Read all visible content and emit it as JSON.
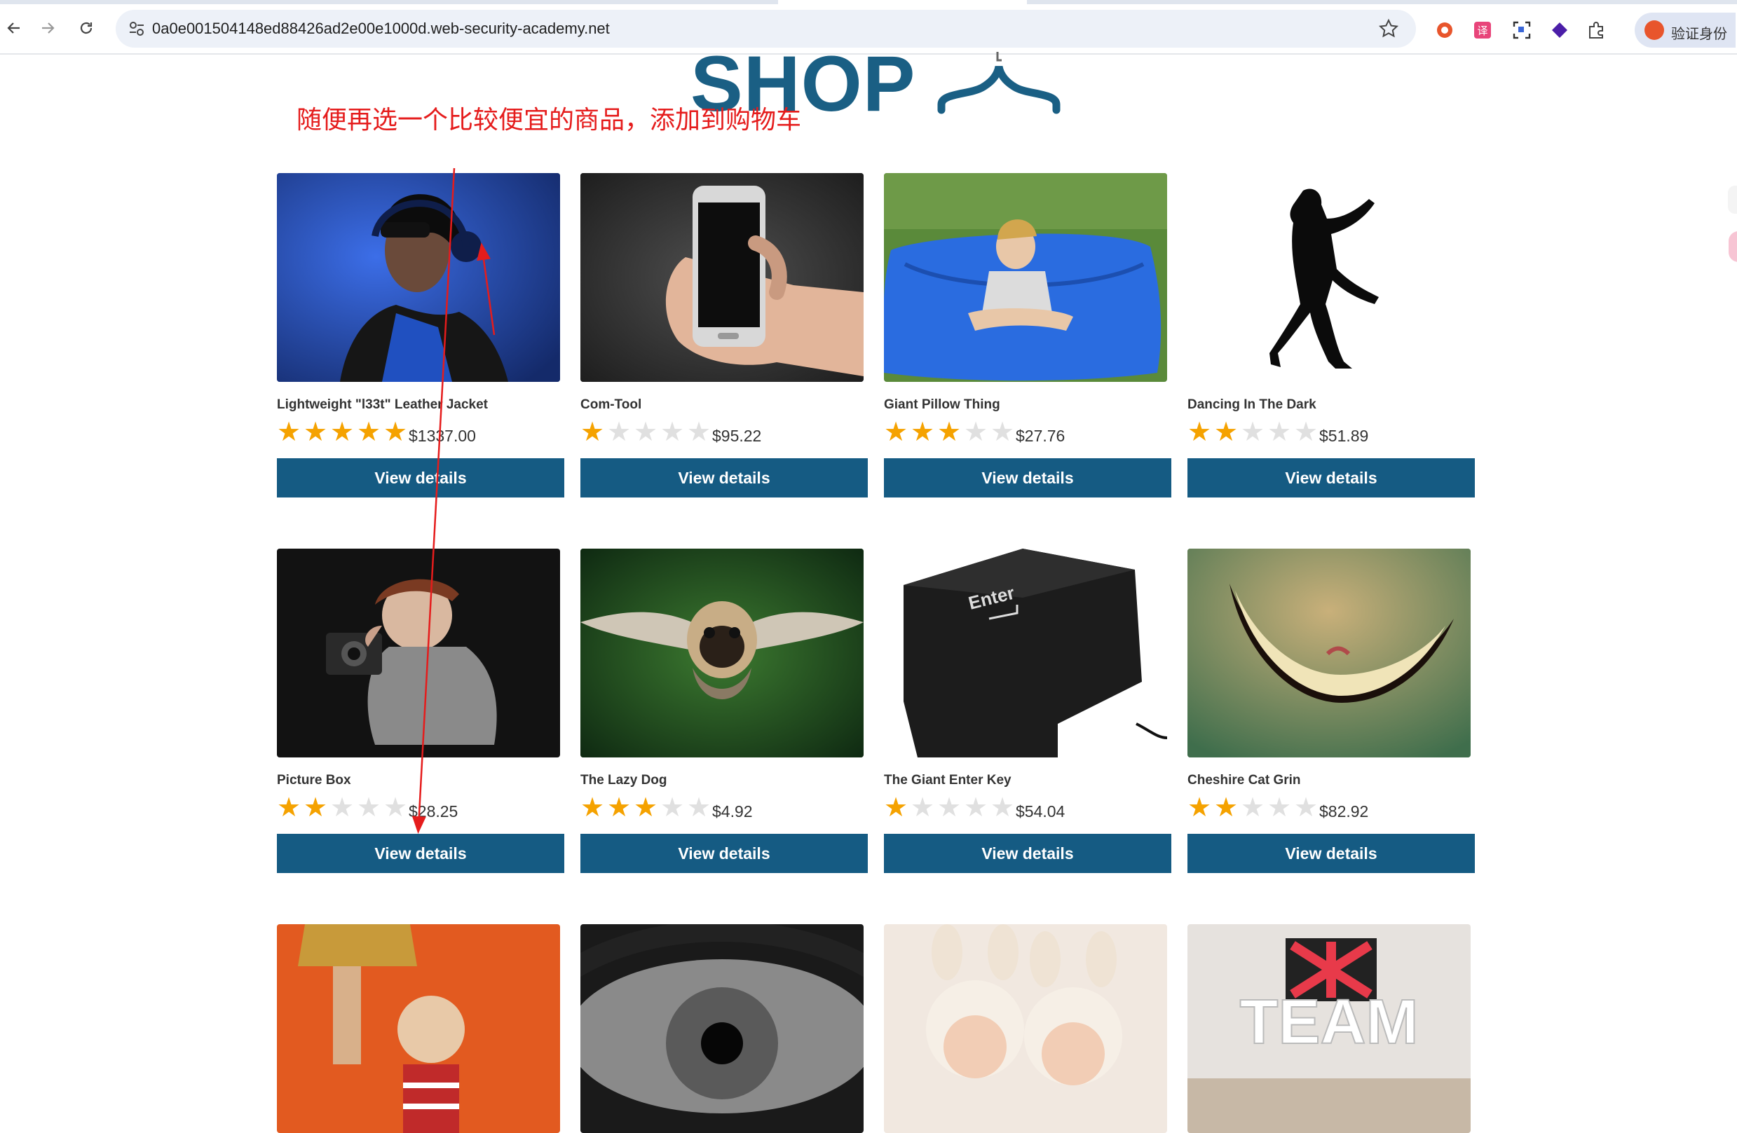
{
  "browser": {
    "url": "0a0e001504148ed88426ad2e00e1000d.web-security-academy.net",
    "profile_label": "验证身份"
  },
  "page": {
    "shop_title": "SHOP",
    "annotation": "随便再选一个比较便宜的商品，添加到购物车"
  },
  "products": [
    {
      "name": "Lightweight \"l33t\" Leather Jacket",
      "rating": 5,
      "price": "$1337.00",
      "button": "View details"
    },
    {
      "name": "Com-Tool",
      "rating": 1,
      "price": "$95.22",
      "button": "View details"
    },
    {
      "name": "Giant Pillow Thing",
      "rating": 3,
      "price": "$27.76",
      "button": "View details"
    },
    {
      "name": "Dancing In The Dark",
      "rating": 2,
      "price": "$51.89",
      "button": "View details"
    },
    {
      "name": "Picture Box",
      "rating": 2,
      "price": "$28.25",
      "button": "View details"
    },
    {
      "name": "The Lazy Dog",
      "rating": 3,
      "price": "$4.92",
      "button": "View details"
    },
    {
      "name": "The Giant Enter Key",
      "rating": 1,
      "price": "$54.04",
      "button": "View details"
    },
    {
      "name": "Cheshire Cat Grin",
      "rating": 2,
      "price": "$82.92",
      "button": "View details"
    },
    {
      "name": "",
      "rating": 0,
      "price": "",
      "button": ""
    },
    {
      "name": "",
      "rating": 0,
      "price": "",
      "button": ""
    },
    {
      "name": "",
      "rating": 0,
      "price": "",
      "button": ""
    },
    {
      "name": "",
      "rating": 0,
      "price": "",
      "button": ""
    }
  ]
}
